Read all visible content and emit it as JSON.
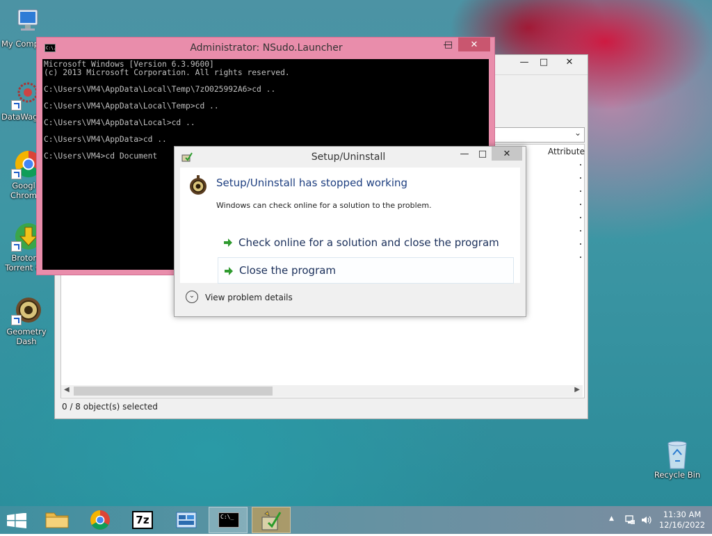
{
  "desktop": {
    "icons": [
      {
        "label": "My Comp"
      },
      {
        "label": "DataWag"
      },
      {
        "label": "Googl Chrom"
      },
      {
        "label": "Brotorre Torrent Clie"
      },
      {
        "label": "Geometry Dash"
      },
      {
        "label": "Recycle Bin"
      }
    ]
  },
  "explorer": {
    "column_header": "Attribute",
    "status": "0 / 8 object(s) selected",
    "dropdown_arrow": "⌄"
  },
  "console": {
    "title": "Administrator: NSudo.Launcher",
    "icon_text": "C:\\.",
    "lines": [
      "Microsoft Windows [Version 6.3.9600]",
      "(c) 2013 Microsoft Corporation. All rights reserved.",
      "",
      "C:\\Users\\VM4\\AppData\\Local\\Temp\\7zO025992A6>cd ..",
      "",
      "C:\\Users\\VM4\\AppData\\Local\\Temp>cd ..",
      "",
      "C:\\Users\\VM4\\AppData\\Local>cd ..",
      "",
      "C:\\Users\\VM4\\AppData>cd ..",
      "",
      "C:\\Users\\VM4>cd Document"
    ]
  },
  "dialog": {
    "title": "Setup/Uninstall",
    "heading": "Setup/Uninstall has stopped working",
    "message": "Windows can check online for a solution to the problem.",
    "option_check": "Check online for a solution and close the program",
    "option_close": "Close the program",
    "details": "View problem details"
  },
  "taskbar": {
    "console_glyph": "C:\\_",
    "sevenzip_label": "7z",
    "time": "11:30 AM",
    "date": "12/16/2022"
  }
}
